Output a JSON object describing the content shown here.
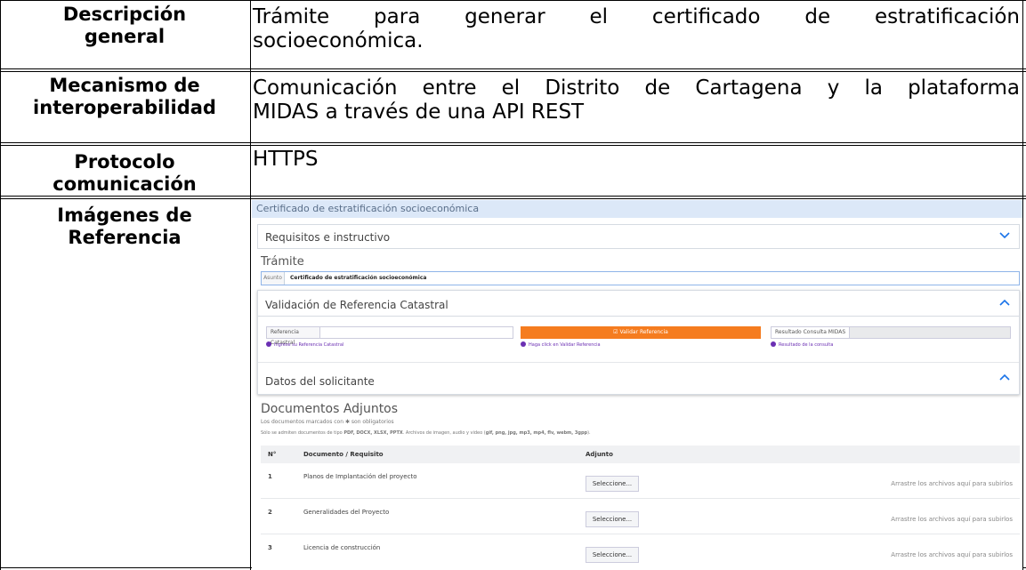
{
  "rows": [
    {
      "label_lines": [
        "Descripción",
        "general"
      ],
      "value_lines": [
        "Trámite para generar el certificado de estratificación",
        "socioeconómica."
      ]
    },
    {
      "label_lines": [
        "Mecanismo de",
        "interoperabilidad"
      ],
      "value_lines": [
        "Comunicación entre el Distrito de Cartagena y la plataforma",
        "MIDAS a través de una API REST"
      ]
    },
    {
      "label_lines": [
        "Protocolo",
        "comunicación"
      ],
      "value_lines": [
        "HTTPS"
      ]
    },
    {
      "label_lines": [
        "Imágenes de",
        "Referencia"
      ]
    }
  ],
  "screenshot": {
    "title": "Certificado de estratificación socioeconómica",
    "requisitos": "Requisitos e instructivo",
    "tramite": "Trámite",
    "asunto_label": "Asunto",
    "asunto_value": "Certificado de estratificación socioeconómica",
    "validacion": "Validación de Referencia Catastral",
    "ref_catastral_label": "Referencia Catastral",
    "ref_catastral_hint": "Ingrese su Referencia Catastral",
    "validar_button": "Validar Referencia",
    "validar_hint": "Haga click en Validar Referencia",
    "resultado_label": "Resultado Consulta MIDAS",
    "resultado_hint": "Resultado de la consulta",
    "datos_solicitante": "Datos del solicitante",
    "documentos_title": "Documentos Adjuntos",
    "note_prefix": "Los documentos marcados con",
    "note_star": "✱",
    "note_suffix": "son obligatorios",
    "types_prefix": "Sólo se admiten documentos de tipo",
    "types_office": "PDF, DOCX, XLSX, PPTX",
    "types_middle": ". Archivos de imagen, audio y video (",
    "types_media": "gif, png, jpg, mp3, mp4, flv, webm, 3gpp",
    "types_suffix": ").",
    "table_headers": [
      "N°",
      "Documento / Requisito",
      "Adjunto"
    ],
    "table_rows": [
      {
        "n": "1",
        "doc": "Planos de Implantación del proyecto"
      },
      {
        "n": "2",
        "doc": "Generalidades del Proyecto"
      },
      {
        "n": "3",
        "doc": "Licencia de construcción"
      }
    ],
    "select_label": "Seleccione...",
    "drop_text": "Arrastre los archivos aquí para subirlos"
  }
}
